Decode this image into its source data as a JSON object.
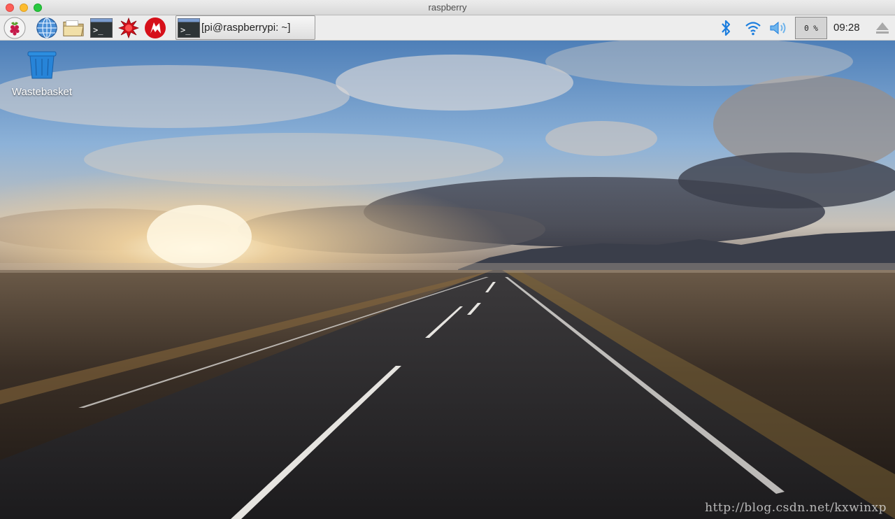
{
  "window": {
    "title": "raspberry"
  },
  "panel": {
    "launchers": [
      {
        "name": "raspberry-menu-icon"
      },
      {
        "name": "web-browser-icon"
      },
      {
        "name": "file-manager-icon"
      },
      {
        "name": "terminal-icon"
      },
      {
        "name": "mathematica-icon"
      },
      {
        "name": "wolfram-icon"
      }
    ],
    "task": {
      "label": "[pi@raspberrypi: ~]"
    },
    "tray": {
      "cpu_label": "0 %",
      "cpu_usage_percent": 0,
      "clock": "09:28",
      "icons": [
        "bluetooth-icon",
        "wifi-icon",
        "volume-icon",
        "eject-icon"
      ]
    }
  },
  "desktop": {
    "icons": [
      {
        "label": "Wastebasket",
        "icon": "wastebasket-icon"
      }
    ],
    "watermark": "http://blog.csdn.net/kxwinxp"
  },
  "colors": {
    "accent_blue": "#1d7ede",
    "raspberry_red": "#c51a4a",
    "panel_bg": "#ededed"
  }
}
